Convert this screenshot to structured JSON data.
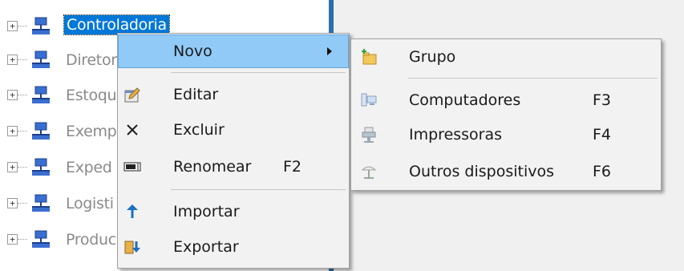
{
  "tree": {
    "expander_glyph": "+",
    "nodes": [
      {
        "label": "Controladoria"
      },
      {
        "label": "Diretor"
      },
      {
        "label": "Estoqu"
      },
      {
        "label": "Exemp"
      },
      {
        "label": "Exped"
      },
      {
        "label": "Logisti"
      },
      {
        "label": "Produc"
      }
    ]
  },
  "context_menu": {
    "items": [
      {
        "label": "Novo",
        "shortcut": ""
      },
      {
        "label": "Editar",
        "shortcut": ""
      },
      {
        "label": "Excluir",
        "shortcut": ""
      },
      {
        "label": "Renomear",
        "shortcut": "F2"
      },
      {
        "label": "Importar",
        "shortcut": ""
      },
      {
        "label": "Exportar",
        "shortcut": ""
      }
    ],
    "icons": [
      "new-submenu-arrow",
      "edit-icon",
      "delete-icon",
      "rename-icon",
      "import-icon",
      "export-icon"
    ]
  },
  "submenu": {
    "items": [
      {
        "label": "Grupo",
        "shortcut": ""
      },
      {
        "label": "Computadores",
        "shortcut": "F3"
      },
      {
        "label": "Impressoras",
        "shortcut": "F4"
      },
      {
        "label": "Outros dispositivos",
        "shortcut": "F6"
      }
    ],
    "icons": [
      "new-group-folder-icon",
      "computer-icon",
      "printer-icon",
      "other-device-icon"
    ]
  },
  "colors": {
    "selection": "#0078d7",
    "menu_highlight": "#91c9f7",
    "divider": "#2a6fb0",
    "menu_bg": "#f2f2f2"
  }
}
